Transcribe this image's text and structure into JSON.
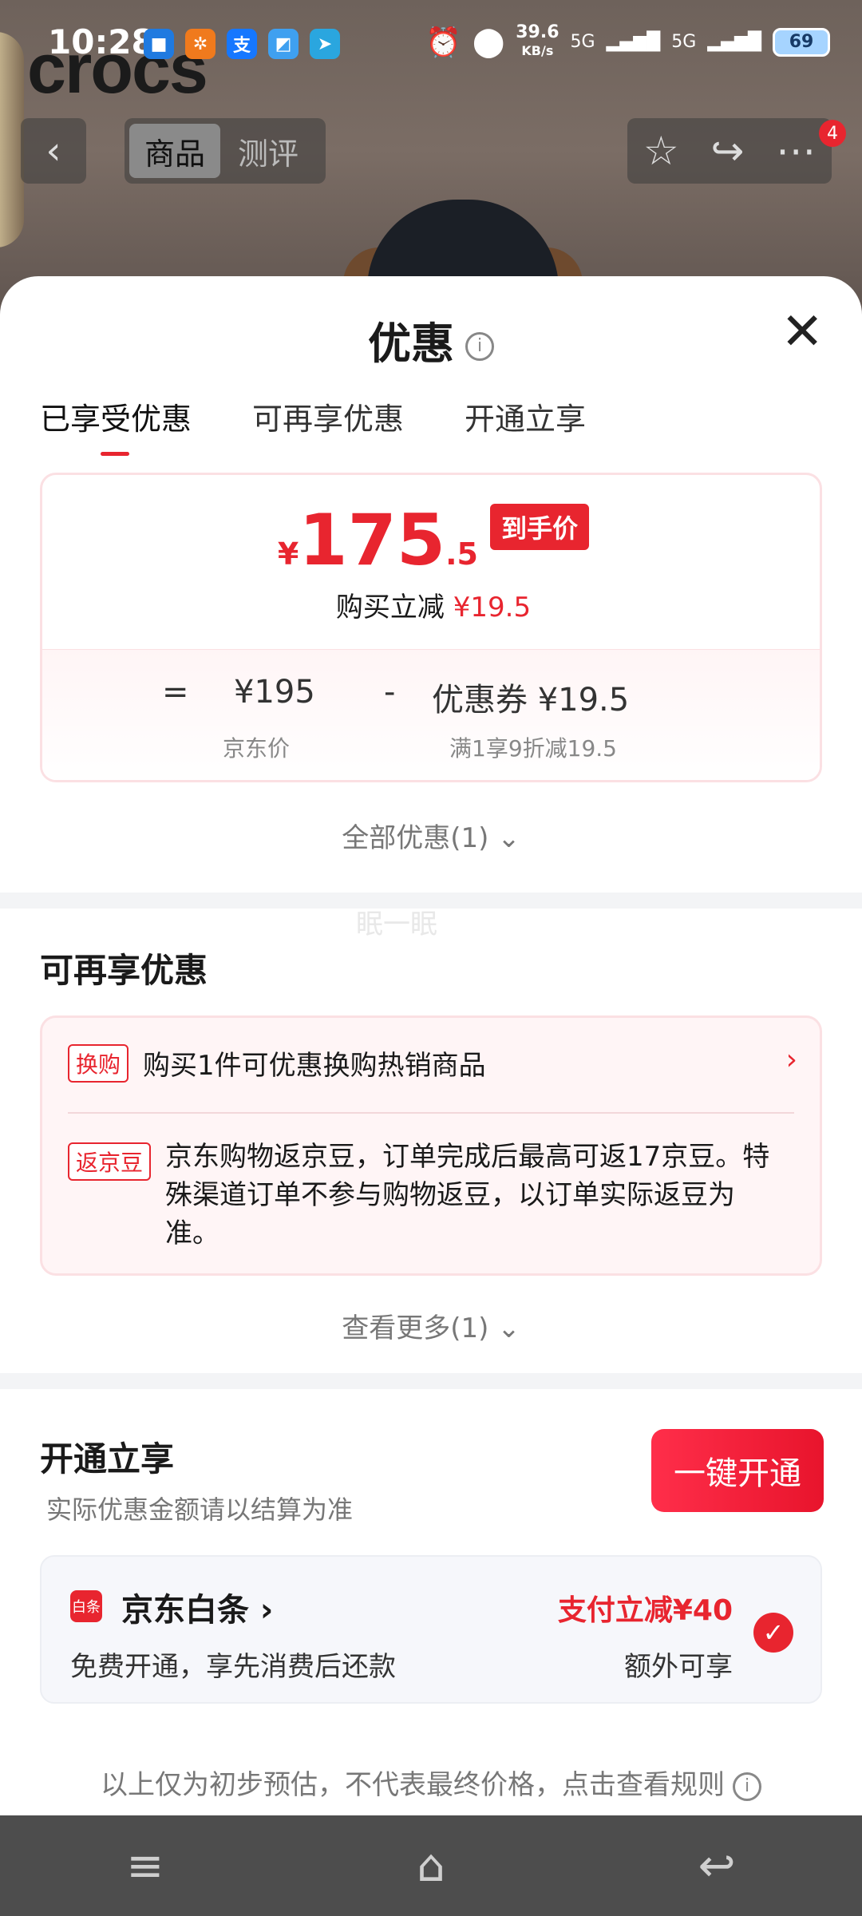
{
  "status_bar": {
    "time": "10:28",
    "net_speed": "39.6",
    "net_unit": "KB/s",
    "signal1": "5G",
    "signal2": "5G",
    "battery": "69"
  },
  "background": {
    "brand_text": "crocs"
  },
  "nav": {
    "tabs": [
      "商品",
      "测评"
    ],
    "notification_count": "4"
  },
  "sheet": {
    "title": "优惠",
    "tabs": [
      "已享受优惠",
      "可再享优惠",
      "开通立享"
    ],
    "price_card": {
      "currency": "¥",
      "price_int": "175",
      "price_dec": ".5",
      "price_tag": "到手价",
      "saving_label": "购买立减",
      "saving_value": "¥19.5",
      "eq": "=",
      "base_price": "¥195",
      "base_label": "京东价",
      "minus": "-",
      "coupon_text": "优惠券 ¥19.5",
      "coupon_desc": "满1享9折减19.5"
    },
    "all_discounts": "全部优惠(1) ⌄",
    "watermark": "眠一眠",
    "more_section": {
      "title": "可再享优惠",
      "items": [
        {
          "label": "换购",
          "text": "购买1件可优惠换购热销商品"
        },
        {
          "label": "返京豆",
          "text": "京东购物返京豆，订单完成后最高可返17京豆。特殊渠道订单不参与购物返豆，以订单实际返豆为准。"
        }
      ],
      "see_more": "查看更多(1) ⌄"
    },
    "open_section": {
      "title": "开通立享",
      "subtitle": "实际优惠金额请以结算为准",
      "button": "一键开通",
      "baitiao": {
        "icon_text": "白条",
        "name": "京东白条 ›",
        "desc": "免费开通，享先消费后还款",
        "promo": "支付立减¥40",
        "extra": "额外可享"
      }
    },
    "footnote": "以上仅为初步预估，不代表最终价格，点击查看规则"
  }
}
